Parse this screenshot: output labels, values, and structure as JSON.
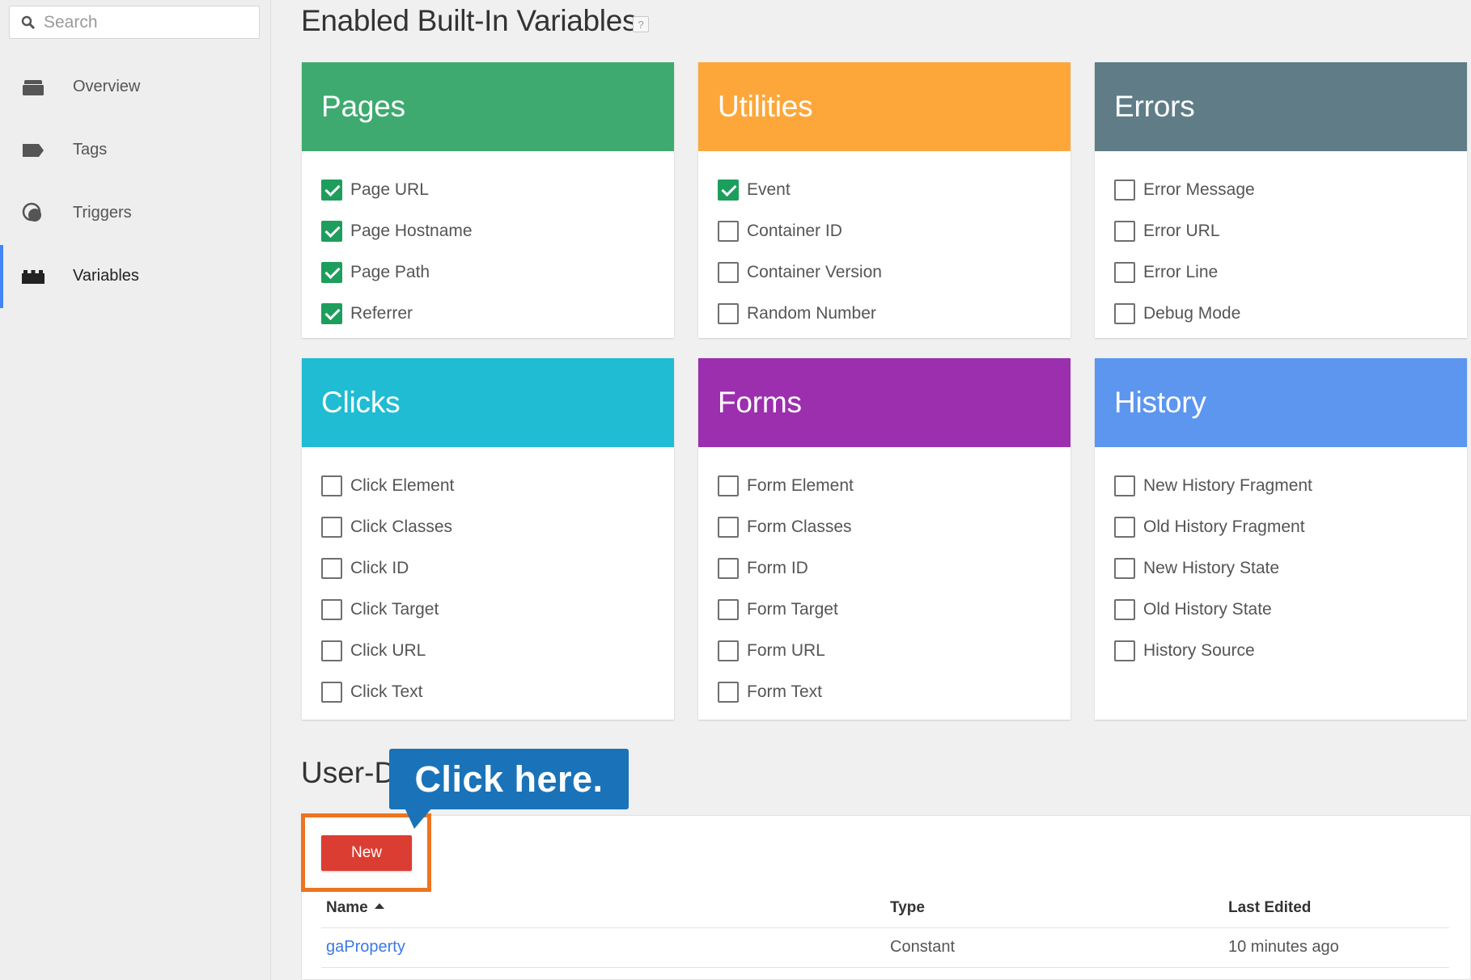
{
  "search": {
    "placeholder": "Search"
  },
  "sidebar": {
    "items": [
      {
        "label": "Overview",
        "icon": "briefcase-icon"
      },
      {
        "label": "Tags",
        "icon": "tag-icon"
      },
      {
        "label": "Triggers",
        "icon": "trigger-icon"
      },
      {
        "label": "Variables",
        "icon": "variables-icon",
        "active": true
      }
    ]
  },
  "main": {
    "title": "Enabled Built-In Variables",
    "help_label": "?",
    "groups": [
      {
        "title": "Pages",
        "color": "#3eaa6f",
        "items": [
          {
            "label": "Page URL",
            "checked": true
          },
          {
            "label": "Page Hostname",
            "checked": true
          },
          {
            "label": "Page Path",
            "checked": true
          },
          {
            "label": "Referrer",
            "checked": true
          }
        ]
      },
      {
        "title": "Utilities",
        "color": "#fda73b",
        "items": [
          {
            "label": "Event",
            "checked": true
          },
          {
            "label": "Container ID",
            "checked": false
          },
          {
            "label": "Container Version",
            "checked": false
          },
          {
            "label": "Random Number",
            "checked": false
          }
        ]
      },
      {
        "title": "Errors",
        "color": "#607d87",
        "items": [
          {
            "label": "Error Message",
            "checked": false
          },
          {
            "label": "Error URL",
            "checked": false
          },
          {
            "label": "Error Line",
            "checked": false
          },
          {
            "label": "Debug Mode",
            "checked": false
          }
        ]
      },
      {
        "title": "Clicks",
        "color": "#1fbcd3",
        "items": [
          {
            "label": "Click Element",
            "checked": false
          },
          {
            "label": "Click Classes",
            "checked": false
          },
          {
            "label": "Click ID",
            "checked": false
          },
          {
            "label": "Click Target",
            "checked": false
          },
          {
            "label": "Click URL",
            "checked": false
          },
          {
            "label": "Click Text",
            "checked": false
          }
        ]
      },
      {
        "title": "Forms",
        "color": "#9b2fad",
        "items": [
          {
            "label": "Form Element",
            "checked": false
          },
          {
            "label": "Form Classes",
            "checked": false
          },
          {
            "label": "Form ID",
            "checked": false
          },
          {
            "label": "Form Target",
            "checked": false
          },
          {
            "label": "Form URL",
            "checked": false
          },
          {
            "label": "Form Text",
            "checked": false
          }
        ]
      },
      {
        "title": "History",
        "color": "#5d96ef",
        "items": [
          {
            "label": "New History Fragment",
            "checked": false
          },
          {
            "label": "Old History Fragment",
            "checked": false
          },
          {
            "label": "New History State",
            "checked": false
          },
          {
            "label": "Old History State",
            "checked": false
          },
          {
            "label": "History Source",
            "checked": false
          }
        ]
      }
    ]
  },
  "user_defined": {
    "title": "User-D",
    "new_label": "New",
    "callout": "Click here.",
    "columns": {
      "name": "Name",
      "type": "Type",
      "last_edited": "Last Edited"
    },
    "rows": [
      {
        "name": "gaProperty",
        "type": "Constant",
        "last_edited": "10 minutes ago"
      }
    ]
  }
}
